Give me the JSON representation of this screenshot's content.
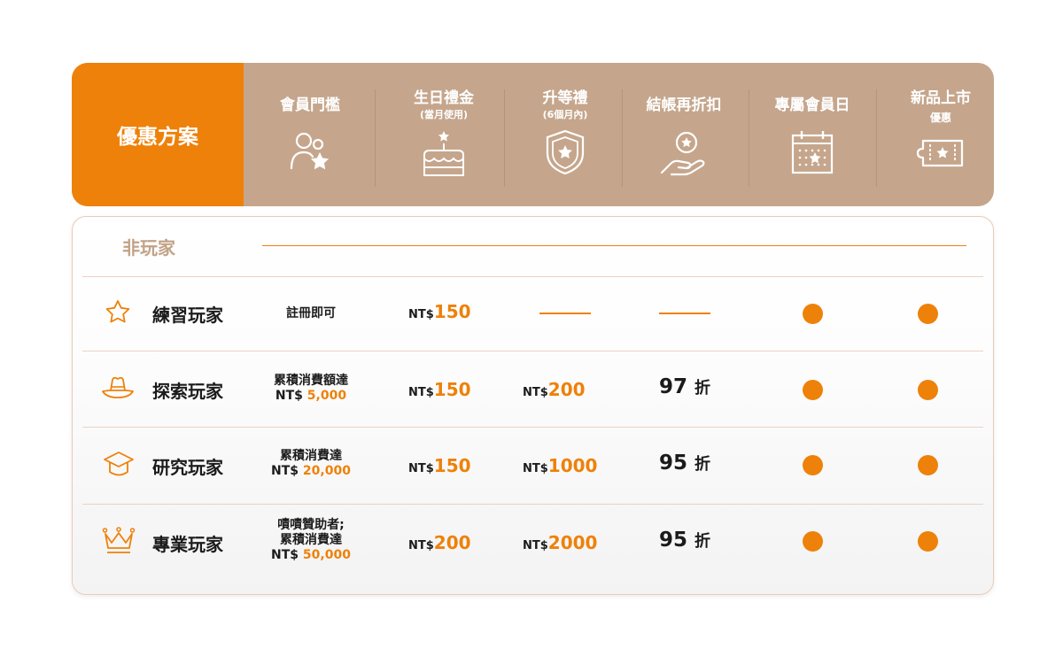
{
  "header": {
    "title": "優惠方案",
    "columns": [
      {
        "label": "會員門檻",
        "sub": "",
        "icon": "member-star-icon"
      },
      {
        "label": "生日禮金",
        "sub": "(當月使用)",
        "icon": "birthday-cake-icon"
      },
      {
        "label": "升等禮",
        "sub": "(6個月內)",
        "icon": "shield-star-icon"
      },
      {
        "label": "結帳再折扣",
        "sub": "",
        "icon": "hand-coin-icon"
      },
      {
        "label": "專屬會員日",
        "sub": "",
        "icon": "calendar-star-icon"
      },
      {
        "label": "新品上市",
        "sub": "優惠",
        "icon": "ticket-star-icon"
      }
    ]
  },
  "section": {
    "title": "非玩家"
  },
  "tiers": [
    {
      "name": "練習玩家",
      "icon": "star-outline-icon",
      "requirement": [
        "註冊即可"
      ],
      "requirement_amount": "",
      "birthday": {
        "currency": "NT$",
        "value": "150"
      },
      "upgrade": null,
      "discount": null,
      "member_day": true,
      "new_product": true
    },
    {
      "name": "探索玩家",
      "icon": "hat-icon",
      "requirement": [
        "累積消費額達",
        "NT$"
      ],
      "requirement_amount": "5,000",
      "birthday": {
        "currency": "NT$",
        "value": "150"
      },
      "upgrade": {
        "currency": "NT$",
        "value": "200"
      },
      "discount": {
        "value": "97",
        "unit": "折"
      },
      "member_day": true,
      "new_product": true
    },
    {
      "name": "研究玩家",
      "icon": "graduation-cap-icon",
      "requirement": [
        "累積消費達",
        "NT$"
      ],
      "requirement_amount": "20,000",
      "birthday": {
        "currency": "NT$",
        "value": "150"
      },
      "upgrade": {
        "currency": "NT$",
        "value": "1000"
      },
      "discount": {
        "value": "95",
        "unit": "折"
      },
      "member_day": true,
      "new_product": true
    },
    {
      "name": "專業玩家",
      "icon": "crown-icon",
      "requirement": [
        "嘖嘖贊助者;",
        "累積消費達",
        "NT$"
      ],
      "requirement_amount": "50,000",
      "birthday": {
        "currency": "NT$",
        "value": "200"
      },
      "upgrade": {
        "currency": "NT$",
        "value": "2000"
      },
      "discount": {
        "value": "95",
        "unit": "折"
      },
      "member_day": true,
      "new_product": true
    }
  ],
  "colors": {
    "accent": "#ee8109",
    "header_bg": "#c5a68c",
    "section_title": "#c2a287"
  }
}
